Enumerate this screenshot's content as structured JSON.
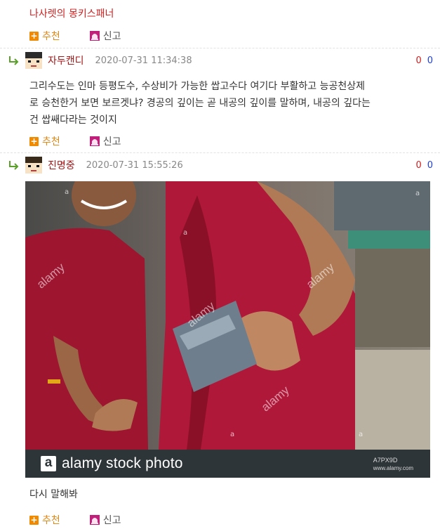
{
  "comments": [
    {
      "text": "나사렛의 몽키스패너",
      "recommend_label": "추천",
      "report_label": "신고"
    },
    {
      "nickname": "자두캔디",
      "date": "2020-07-31 11:34:38",
      "votes_up": "0",
      "votes_down": "0",
      "body_lines": [
        "그리수도는 인마 등평도수, 수상비가 가능한 쌉고수다 여기다 부활하고 능공천상제",
        "로 승천한거 보면 보르겟냐? 경공의 깊이는 곧 내공의 깊이를 말하며, 내공의 깊다는",
        "건 쌉쌔다라는 것이지"
      ],
      "recommend_label": "추천",
      "report_label": "신고"
    },
    {
      "nickname": "진명중",
      "date": "2020-07-31 15:55:26",
      "votes_up": "0",
      "votes_down": "0",
      "photo": {
        "watermark": "alamy",
        "logo_letter": "a",
        "logo_text": "alamy stock photo",
        "image_id": "A7PX9D",
        "site": "www.alamy.com"
      },
      "text": "다시 말해봐",
      "recommend_label": "추천",
      "report_label": "신고"
    }
  ],
  "colors": {
    "nickname": "#a01818",
    "vote_up": "#d02020",
    "vote_down": "#2040d0",
    "recommend": "#e08a1e",
    "robe": "#b0183a"
  }
}
